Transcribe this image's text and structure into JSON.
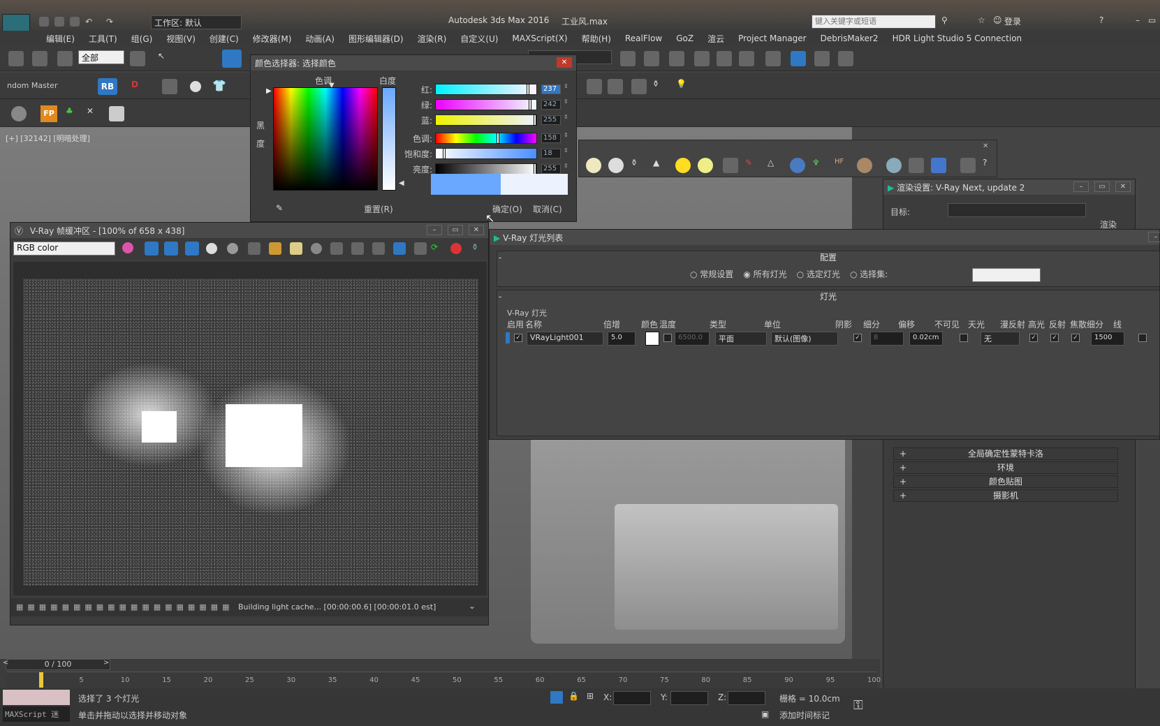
{
  "app": {
    "title": "Autodesk 3ds Max 2016",
    "file": "工业风.max",
    "workspace": "工作区: 默认",
    "search_placeholder": "键入关键字或短语",
    "login": "登录",
    "logo": "MAX"
  },
  "menu": [
    "编辑(E)",
    "工具(T)",
    "组(G)",
    "视图(V)",
    "创建(C)",
    "修改器(M)",
    "动画(A)",
    "图形编辑器(D)",
    "渲染(R)",
    "自定义(U)",
    "MAXScript(X)",
    "帮助(H)",
    "RealFlow",
    "GoZ",
    "渲云",
    "Project Manager",
    "DebrisMaker2",
    "HDR Light Studio 5 Connection"
  ],
  "toolbar": {
    "filter": "全部",
    "ndom_master": "ndom Master",
    "rb": "RB",
    "fp": "FP"
  },
  "viewport": {
    "label": "[+] [32142] [明暗处理]"
  },
  "color_picker": {
    "title": "颜色选择器: 选择颜色",
    "hue_label": "色调",
    "whiteness_label": "白度",
    "black_label_1": "黑",
    "black_label_2": "度",
    "channels": [
      {
        "label": "红:",
        "value": "237"
      },
      {
        "label": "绿:",
        "value": "242"
      },
      {
        "label": "蓝:",
        "value": "255"
      },
      {
        "label": "色调:",
        "value": "158"
      },
      {
        "label": "饱和度:",
        "value": "18"
      },
      {
        "label": "亮度:",
        "value": "255"
      }
    ],
    "reset": "重置(R)",
    "ok": "确定(O)",
    "cancel": "取消(C)",
    "swatch_old": "#6aa8ff",
    "swatch_new": "#edf2ff"
  },
  "vfb": {
    "title": "V-Ray 帧缓冲区 - [100% of 658 x 438]",
    "channel": "RGB color",
    "status": "Building light cache... [00:00:00.6] [00:00:01.0 est]"
  },
  "render_settings": {
    "title": "渲染设置: V-Ray Next, update 2",
    "target_label": "目标:",
    "render_button": "渲染",
    "rollouts": [
      "全局确定性蒙特卡洛",
      "环境",
      "颜色贴图",
      "摄影机"
    ]
  },
  "light_lister": {
    "title": "V-Ray 灯光列表",
    "config_header": "配置",
    "radio": [
      {
        "label": "常规设置",
        "checked": false
      },
      {
        "label": "所有灯光",
        "checked": true
      },
      {
        "label": "选定灯光",
        "checked": false
      },
      {
        "label": "选择集:",
        "checked": false
      }
    ],
    "lights_header": "灯光",
    "group_label": "V-Ray 灯光",
    "columns": [
      "启用",
      "名称",
      "倍增",
      "颜色",
      "温度",
      "类型",
      "单位",
      "阴影",
      "细分",
      "偏移",
      "不可见",
      "天光",
      "漫反射",
      "高光",
      "反射",
      "焦散细分",
      "线"
    ],
    "row": {
      "name": "VRayLight001",
      "multiplier": "5.0",
      "temperature": "6500.0",
      "type": "平面",
      "unit": "默认(图像)",
      "subdiv": "8",
      "bias": "0.02cm",
      "skylight": "无",
      "caustics_subdiv": "1500"
    }
  },
  "timeline": {
    "frame": "0 / 100",
    "ticks": [
      "5",
      "10",
      "15",
      "20",
      "25",
      "30",
      "35",
      "40",
      "45",
      "50",
      "55",
      "60",
      "65",
      "70",
      "75",
      "80",
      "85",
      "90",
      "95",
      "100"
    ]
  },
  "status": {
    "maxscript": "MAXScript 迷",
    "selected": "选择了 3 个灯光",
    "hint": "单击并拖动以选择并移动对象",
    "x_label": "X:",
    "y_label": "Y:",
    "z_label": "Z:",
    "grid": "栅格 = 10.0cm",
    "add_time_tag": "添加时间标记"
  }
}
